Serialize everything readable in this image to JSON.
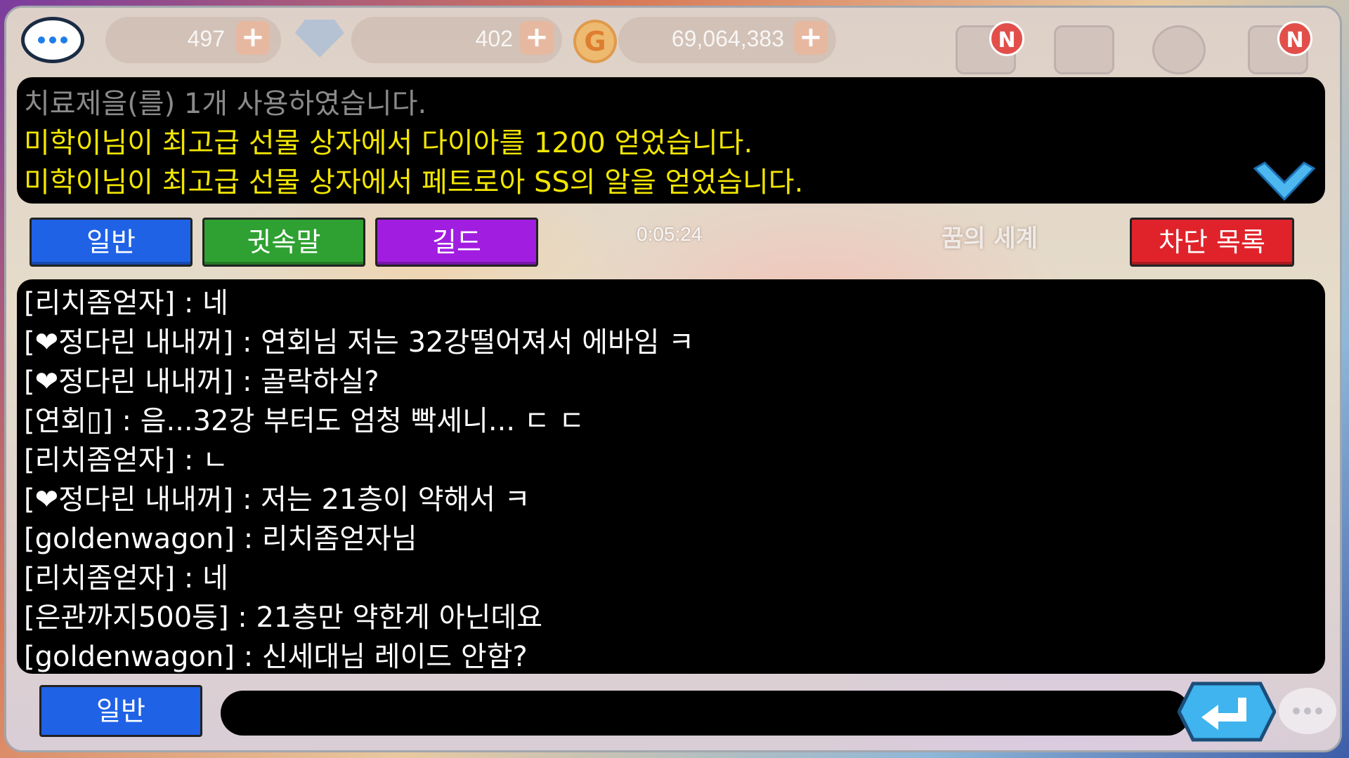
{
  "hud": {
    "gem_count": "497",
    "diamond_count": "402",
    "gold_count": "69,064,383",
    "plus_symbol": "+",
    "coin_symbol": "G",
    "badge_text": "N"
  },
  "system_messages": [
    {
      "text": "치료제을(를) 1개 사용하였습니다.",
      "color": "#8a8a8a"
    },
    {
      "text": "미학이님이 최고급 선물 상자에서 다이아를 1200 얻었습니다.",
      "color": "#f2e600"
    },
    {
      "text": "미학이님이 최고급 선물 상자에서 페트로아 SS의 알을 얻었습니다.",
      "color": "#f2e600"
    }
  ],
  "tabs": {
    "general": "일반",
    "whisper": "귓속말",
    "guild": "길드",
    "block_list": "차단 목록"
  },
  "timer": "0:05:24",
  "background_title": "꿈의 세계",
  "chat_messages": [
    "[리치좀얻자] : 네",
    "[❤정다린 내내꺼] : 연회님 저는 32강떨어져서 에바임 ㅋ",
    "[❤정다린 내내꺼] : 골락하실?",
    "[연회▯] : 음...32강 부터도 엄청 빡세니... ㄷ ㄷ",
    "[리치좀얻자] : ㄴ",
    "[❤정다린 내내꺼] : 저는 21층이 약해서 ㅋ",
    "[goldenwagon] : 리치좀얻자님",
    "[리치좀얻자] : 네",
    "[은관까지500등] : 21층만 약한게 아닌데요",
    "[goldenwagon] : 신세대님 레이드 안함?"
  ],
  "input": {
    "mode_label": "일반",
    "value": ""
  },
  "colors": {
    "tab_blue": "#1f62e6",
    "tab_green": "#2fa132",
    "tab_purple": "#a11ee0",
    "tab_red": "#e0232b",
    "system_yellow": "#f2e600",
    "panel_black": "#000000"
  },
  "icons": [
    "chat-bubble-icon",
    "gem-icon",
    "gold-coin-icon",
    "mail-icon",
    "pet-icon",
    "location-icon",
    "quest-list-icon",
    "chevron-down-icon",
    "enter-arrow-icon"
  ]
}
